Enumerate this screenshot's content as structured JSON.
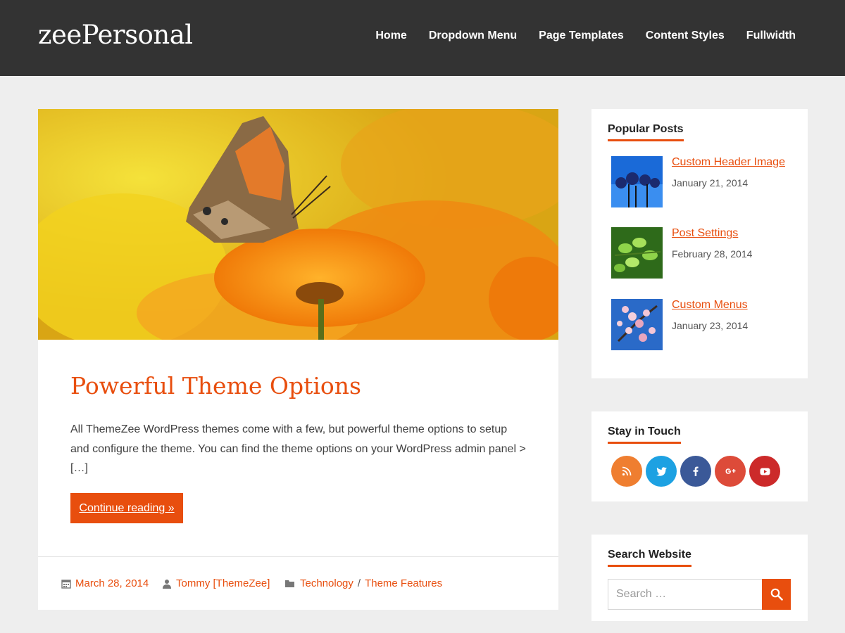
{
  "site": {
    "title": "zeePersonal"
  },
  "nav": {
    "items": [
      {
        "label": "Home"
      },
      {
        "label": "Dropdown Menu"
      },
      {
        "label": "Page Templates"
      },
      {
        "label": "Content Styles"
      },
      {
        "label": "Fullwidth"
      }
    ]
  },
  "post": {
    "title": "Powerful Theme Options",
    "excerpt": "All ThemeZee WordPress themes come with a few, but powerful theme options to setup and configure the theme. You can find the theme options on your WordPress admin panel > […]",
    "read_more": "Continue reading »",
    "date": "March 28, 2014",
    "author": "Tommy [ThemeZee]",
    "categories": [
      "Technology",
      "Theme Features"
    ],
    "category_separator": "/"
  },
  "sidebar": {
    "popular": {
      "title": "Popular Posts",
      "items": [
        {
          "label": "Custom Header Image",
          "date": "January 21, 2014"
        },
        {
          "label": "Post Settings",
          "date": "February 28, 2014"
        },
        {
          "label": "Custom Menus",
          "date": "January 23, 2014"
        }
      ]
    },
    "touch": {
      "title": "Stay in Touch",
      "icons": [
        "rss-icon",
        "twitter-icon",
        "facebook-icon",
        "google-plus-icon",
        "youtube-icon"
      ]
    },
    "search": {
      "title": "Search Website",
      "placeholder": "Search …"
    }
  },
  "colors": {
    "accent": "#e84e0e",
    "header_bg": "#333333",
    "page_bg": "#eeeeee",
    "rss": "#ef7e30",
    "twitter": "#1da1e2",
    "facebook": "#3b5998",
    "google_plus": "#dd4b39",
    "youtube": "#cc2a2a"
  }
}
